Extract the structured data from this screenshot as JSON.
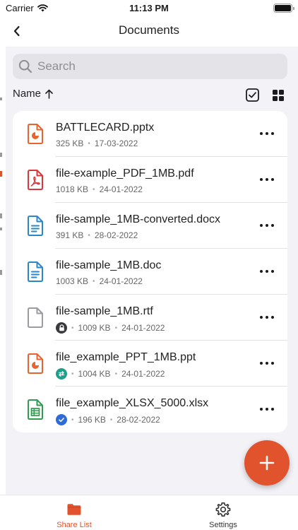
{
  "status_bar": {
    "carrier": "Carrier",
    "time": "11:13 PM",
    "battery_level": 1.0
  },
  "nav": {
    "title": "Documents",
    "back_icon": "chevron-left-icon"
  },
  "search": {
    "placeholder": "Search",
    "value": "",
    "icon": "search-icon"
  },
  "sort": {
    "label": "Name",
    "direction_icon": "arrow-up-icon",
    "select_icon": "checkbox-icon",
    "view_icon": "grid-view-icon"
  },
  "files": [
    {
      "name": "BATTLECARD.pptx",
      "size": "325 KB",
      "date": "17-03-2022",
      "type": "presentation",
      "color": "#e8632d",
      "badge": null
    },
    {
      "name": "file-example_PDF_1MB.pdf",
      "size": "1018 KB",
      "date": "24-01-2022",
      "type": "pdf",
      "color": "#d9383a",
      "badge": null
    },
    {
      "name": "file-sample_1MB-converted.docx",
      "size": "391 KB",
      "date": "28-02-2022",
      "type": "document",
      "color": "#2b87c8",
      "badge": null
    },
    {
      "name": "file-sample_1MB.doc",
      "size": "1003 KB",
      "date": "24-01-2022",
      "type": "document",
      "color": "#2b87c8",
      "badge": null
    },
    {
      "name": "file-sample_1MB.rtf",
      "size": "1009 KB",
      "date": "24-01-2022",
      "type": "generic",
      "color": "#9b9ba0",
      "badge": "lock-icon"
    },
    {
      "name": "file_example_PPT_1MB.ppt",
      "size": "1004 KB",
      "date": "24-01-2022",
      "type": "presentation",
      "color": "#e8632d",
      "badge": "sync-icon"
    },
    {
      "name": "file_example_XLSX_5000.xlsx",
      "size": "196 KB",
      "date": "28-02-2022",
      "type": "spreadsheet",
      "color": "#2e9b4e",
      "badge": "check-icon"
    }
  ],
  "fab": {
    "icon": "plus-icon",
    "color": "#e0532c"
  },
  "tabs": [
    {
      "label": "Share List",
      "icon": "folder-icon",
      "active": true,
      "color": "#e0532c"
    },
    {
      "label": "Settings",
      "icon": "gear-icon",
      "active": false,
      "color": "#333333"
    }
  ]
}
